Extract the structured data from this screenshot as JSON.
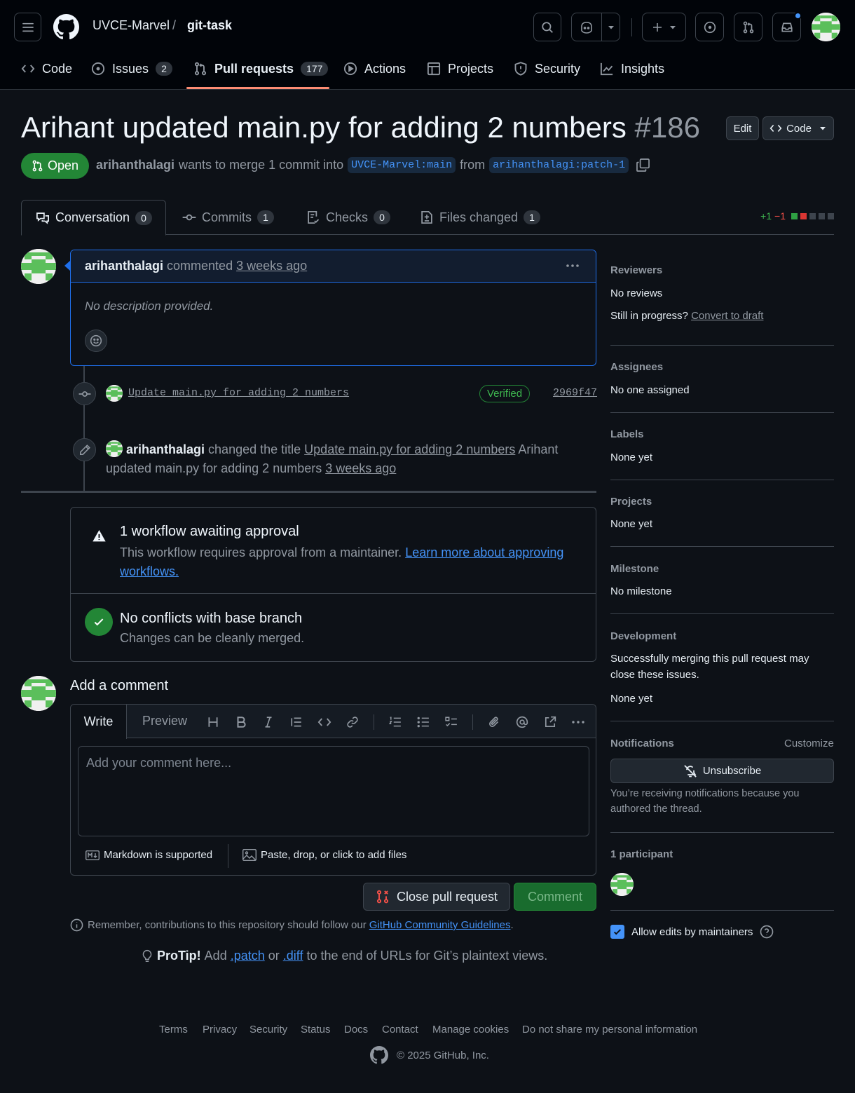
{
  "header": {
    "owner": "UVCE-Marvel",
    "separator": "/",
    "repo": "git-task",
    "tabs": [
      {
        "label": "Code",
        "count": ""
      },
      {
        "label": "Issues",
        "count": "2"
      },
      {
        "label": "Pull requests",
        "count": "177"
      },
      {
        "label": "Actions",
        "count": ""
      },
      {
        "label": "Projects",
        "count": ""
      },
      {
        "label": "Security",
        "count": ""
      },
      {
        "label": "Insights",
        "count": ""
      }
    ]
  },
  "pr": {
    "title": "Arihant updated main.py for adding 2 numbers",
    "number": "#186",
    "edit_label": "Edit",
    "code_label": "Code",
    "state": "Open",
    "author": "arihanthalagi",
    "merge_text": "wants to merge 1 commit into",
    "base_branch": "UVCE-Marvel:main",
    "from_text": "from",
    "head_branch": "arihanthalagi:patch-1"
  },
  "pr_tabs": [
    {
      "label": "Conversation",
      "count": "0"
    },
    {
      "label": "Commits",
      "count": "1"
    },
    {
      "label": "Checks",
      "count": "0"
    },
    {
      "label": "Files changed",
      "count": "1"
    }
  ],
  "diffstat": {
    "added": "+1",
    "removed": "−1"
  },
  "comment": {
    "author": "arihanthalagi",
    "action": "commented",
    "time": "3 weeks ago",
    "body": "No description provided."
  },
  "commit": {
    "message": "Update main.py for adding 2 numbers",
    "verified": "Verified",
    "sha": "2969f47"
  },
  "rename_event": {
    "author": "arihanthalagi",
    "action": "changed the title",
    "old_title": "Update main.py for adding 2 numbers",
    "new_title_part1": "Arihant updated",
    "new_title_part2": "main.py for adding 2 numbers",
    "time": "3 weeks ago"
  },
  "merge_box": {
    "workflow_title": "1 workflow awaiting approval",
    "workflow_text": "This workflow requires approval from a maintainer.",
    "workflow_link1": "Learn more about approving",
    "workflow_link2": "workflows.",
    "conflict_title": "No conflicts with base branch",
    "conflict_text": "Changes can be cleanly merged."
  },
  "new_comment": {
    "heading": "Add a comment",
    "write_tab": "Write",
    "preview_tab": "Preview",
    "placeholder": "Add your comment here...",
    "markdown_note": "Markdown is supported",
    "attach_note": "Paste, drop, or click to add files",
    "close_label": "Close pull request",
    "comment_label": "Comment"
  },
  "notes": {
    "guidelines_prefix": "Remember, contributions to this repository should follow our",
    "guidelines_link": "GitHub Community Guidelines",
    "guidelines_suffix": ".",
    "protip_label": "ProTip!",
    "protip_add": "Add",
    "protip_patch": ".patch",
    "protip_or": "or",
    "protip_diff": ".diff",
    "protip_suffix": "to the end of URLs for Git’s plaintext views."
  },
  "sidebar": {
    "reviewers_h": "Reviewers",
    "reviewers_v": "No reviews",
    "draft_q": "Still in progress?",
    "draft_link": "Convert to draft",
    "assignees_h": "Assignees",
    "assignees_v": "No one assigned",
    "labels_h": "Labels",
    "labels_v": "None yet",
    "projects_h": "Projects",
    "projects_v": "None yet",
    "milestone_h": "Milestone",
    "milestone_v": "No milestone",
    "development_h": "Development",
    "development_text1": "Successfully merging this pull request may",
    "development_text2": "close these issues.",
    "development_v": "None yet",
    "notifications_h": "Notifications",
    "customize": "Customize",
    "unsubscribe": "Unsubscribe",
    "notif_text1": "You’re receiving notifications because you",
    "notif_text2": "authored the thread.",
    "participants_h": "1 participant",
    "allow_edits": "Allow edits by maintainers"
  },
  "footer": {
    "links": [
      "Terms",
      "Privacy",
      "Security",
      "Status",
      "Docs",
      "Contact",
      "Manage cookies",
      "Do not share my personal information"
    ],
    "copyright": "© 2025 GitHub, Inc."
  },
  "colors": {
    "background": "#0d1117",
    "header_bg": "#010409",
    "open_green": "#238636",
    "link_blue": "#4493f8",
    "accent_underline": "#fd8c73",
    "danger": "#f85149"
  }
}
